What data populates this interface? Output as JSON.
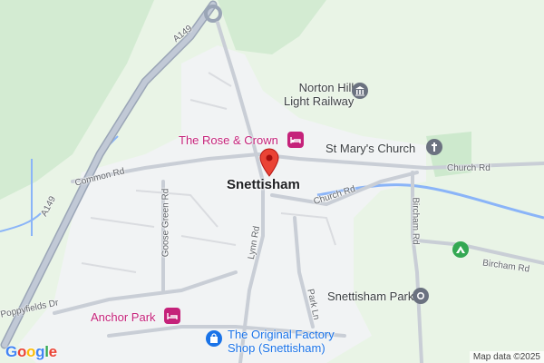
{
  "map": {
    "town": "Snettisham",
    "streets": {
      "a149_north": "A149",
      "a149_south": "A149",
      "common_rd": "Common Rd",
      "goose_green_rd": "Goose Green Rd",
      "lynn_rd": "Lynn Rd",
      "church_rd_west": "Church Rd",
      "church_rd_east": "Church Rd",
      "bircham_rd_vertical": "Bircham Rd",
      "bircham_rd_east": "Bircham Rd",
      "park_ln": "Park Ln",
      "poppyfields_dr": "Poppyfields Dr"
    },
    "places": {
      "norton_hill_line1": "Norton Hill",
      "norton_hill_line2": "Light Railway",
      "rose_crown": "The Rose & Crown",
      "st_marys": "St Mary's Church",
      "snettisham_park": "Snettisham Park",
      "anchor_park": "Anchor Park",
      "factory_shop_line1": "The Original Factory",
      "factory_shop_line2": "Shop (Snettisham)"
    },
    "icons": {
      "pin": "location-pin-icon",
      "museum": "museum-icon",
      "hotel": "hotel-icon",
      "church": "church-icon",
      "park": "park-icon",
      "shop": "shopping-bag-icon",
      "campsite": "campsite-icon"
    },
    "colors": {
      "land": "#e9f4e6",
      "green": "#cde9cd",
      "urban": "#f1f3f4",
      "road": "#c9ced6",
      "water": "#8ab4f8",
      "pin": "#ea4335",
      "pink": "#c5227a",
      "blue": "#1a73e8",
      "grey": "#6b7280",
      "green_icon": "#34a853"
    },
    "attribution": "Map data ©2025",
    "logo": "Google"
  }
}
